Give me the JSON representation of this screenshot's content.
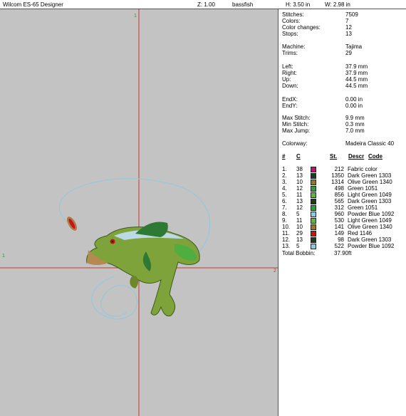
{
  "titlebar": {
    "app_title": "Wilcom ES-65 Designer",
    "zoom": "Z: 1.00",
    "design_name": "bassfish",
    "height": "H: 3.50 in",
    "width": "W: 2.98 in"
  },
  "canvas": {
    "markers": {
      "top": "1",
      "left": "1",
      "right": "2"
    }
  },
  "stats": [
    {
      "label": "Stitches:",
      "value": "7509"
    },
    {
      "label": "Colors:",
      "value": "7"
    },
    {
      "label": "Color changes:",
      "value": "12"
    },
    {
      "label": "Stops:",
      "value": "13"
    },
    {
      "label": "Machine:",
      "value": "Tajima"
    },
    {
      "label": "Trims:",
      "value": "29"
    },
    {
      "label": "Left:",
      "value": "37.9 mm"
    },
    {
      "label": "Right:",
      "value": "37.9 mm"
    },
    {
      "label": "Up:",
      "value": "44.5 mm"
    },
    {
      "label": "Down:",
      "value": "44.5 mm"
    },
    {
      "label": "EndX:",
      "value": "0.00 in"
    },
    {
      "label": "EndY:",
      "value": "0.00 in"
    },
    {
      "label": "Max Stitch:",
      "value": "9.9 mm"
    },
    {
      "label": "Min Stitch:",
      "value": "0.3 mm"
    },
    {
      "label": "Max Jump:",
      "value": "7.0 mm"
    },
    {
      "label": "Colorway:",
      "value": "Madeira Classic 40"
    }
  ],
  "color_table": {
    "headers": {
      "num": "#",
      "code": "C",
      "st": "St.",
      "descr": "Descr",
      "code2": "Code"
    },
    "rows": [
      {
        "n": "1.",
        "c": "38",
        "st": "212",
        "descr": "Fabric color",
        "swatch": "#b4166a"
      },
      {
        "n": "2.",
        "c": "13",
        "st": "1350",
        "descr": "Dark Green 1303",
        "swatch": "#1c3b22"
      },
      {
        "n": "3.",
        "c": "10",
        "st": "1314",
        "descr": "Olive Green 1340",
        "swatch": "#8f7a2c"
      },
      {
        "n": "4.",
        "c": "12",
        "st": "498",
        "descr": "Green 1051",
        "swatch": "#2f9a3e"
      },
      {
        "n": "5.",
        "c": "11",
        "st": "856",
        "descr": "Light Green 1049",
        "swatch": "#5fb441"
      },
      {
        "n": "6.",
        "c": "13",
        "st": "565",
        "descr": "Dark Green 1303",
        "swatch": "#1c3b22"
      },
      {
        "n": "7.",
        "c": "12",
        "st": "312",
        "descr": "Green 1051",
        "swatch": "#2f9a3e"
      },
      {
        "n": "8.",
        "c": "5",
        "st": "960",
        "descr": "Powder Blue 1092",
        "swatch": "#8fc9dc"
      },
      {
        "n": "9.",
        "c": "11",
        "st": "530",
        "descr": "Light Green 1049",
        "swatch": "#5fb441"
      },
      {
        "n": "10.",
        "c": "10",
        "st": "141",
        "descr": "Olive Green 1340",
        "swatch": "#8f7a2c"
      },
      {
        "n": "11.",
        "c": "29",
        "st": "149",
        "descr": "Red 1146",
        "swatch": "#c41616"
      },
      {
        "n": "12.",
        "c": "13",
        "st": "98",
        "descr": "Dark Green 1303",
        "swatch": "#1c3b22"
      },
      {
        "n": "13.",
        "c": "5",
        "st": "522",
        "descr": "Powder Blue 1092",
        "swatch": "#8fc9dc"
      }
    ],
    "total_label": "Total Bobbin:",
    "total_value": "37.90ft"
  }
}
